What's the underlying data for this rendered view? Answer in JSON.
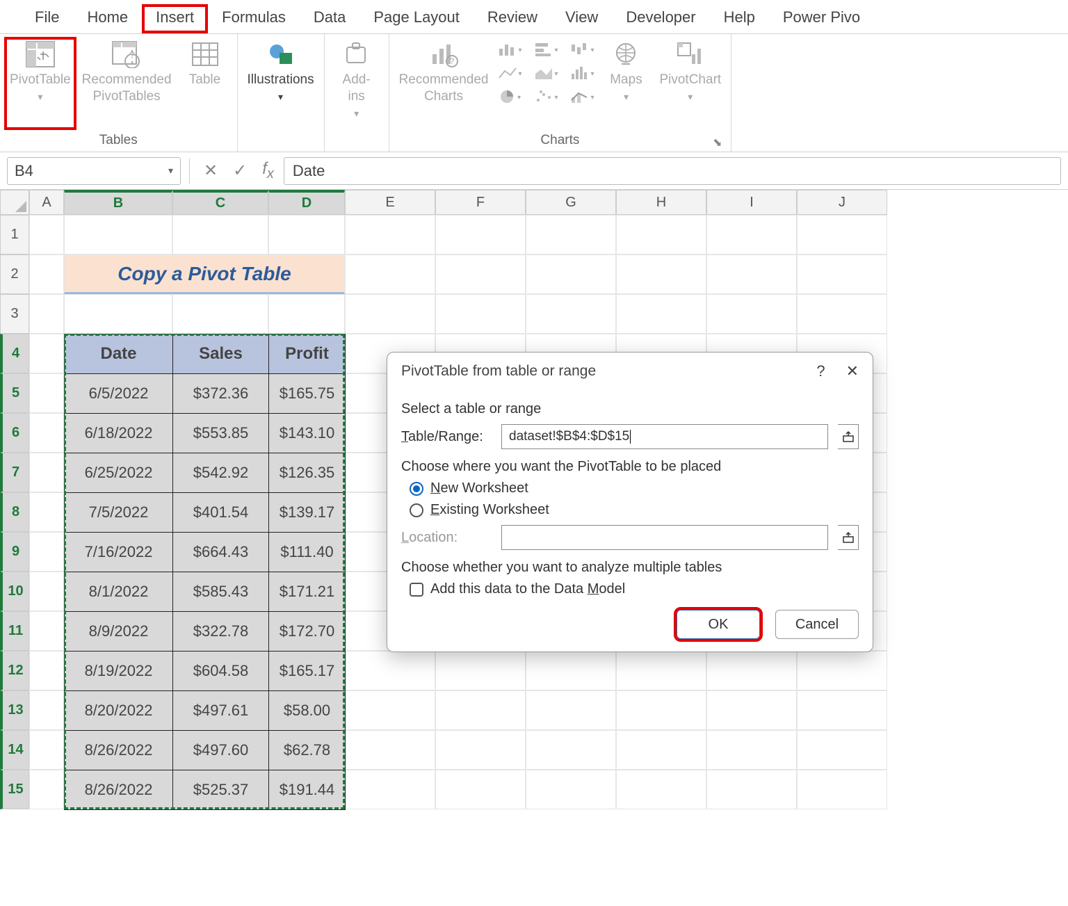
{
  "menu": {
    "file": "File",
    "home": "Home",
    "insert": "Insert",
    "formulas": "Formulas",
    "data": "Data",
    "pageLayout": "Page Layout",
    "review": "Review",
    "view": "View",
    "developer": "Developer",
    "help": "Help",
    "powerPivot": "Power Pivo"
  },
  "ribbon": {
    "pivotTable": "PivotTable",
    "recommendedPivot": "Recommended\nPivotTables",
    "table": "Table",
    "illustrations": "Illustrations",
    "addins": "Add-\nins",
    "recommendedCharts": "Recommended\nCharts",
    "maps": "Maps",
    "pivotChart": "PivotChart",
    "group_tables": "Tables",
    "group_charts": "Charts"
  },
  "formulaBar": {
    "nameBox": "B4",
    "formula": "Date"
  },
  "columns": [
    "A",
    "B",
    "C",
    "D",
    "E",
    "F",
    "G",
    "H",
    "I",
    "J"
  ],
  "rows": [
    "1",
    "2",
    "3",
    "4",
    "5",
    "6",
    "7",
    "8",
    "9",
    "10",
    "11",
    "12",
    "13",
    "14",
    "15"
  ],
  "title": "Copy a Pivot Table",
  "table": {
    "headers": [
      "Date",
      "Sales",
      "Profit"
    ],
    "rows": [
      [
        "6/5/2022",
        "$372.36",
        "$165.75"
      ],
      [
        "6/18/2022",
        "$553.85",
        "$143.10"
      ],
      [
        "6/25/2022",
        "$542.92",
        "$126.35"
      ],
      [
        "7/5/2022",
        "$401.54",
        "$139.17"
      ],
      [
        "7/16/2022",
        "$664.43",
        "$111.40"
      ],
      [
        "8/1/2022",
        "$585.43",
        "$171.21"
      ],
      [
        "8/9/2022",
        "$322.78",
        "$172.70"
      ],
      [
        "8/19/2022",
        "$604.58",
        "$165.17"
      ],
      [
        "8/20/2022",
        "$497.61",
        "$58.00"
      ],
      [
        "8/26/2022",
        "$497.60",
        "$62.78"
      ],
      [
        "8/26/2022",
        "$525.37",
        "$191.44"
      ]
    ]
  },
  "dialog": {
    "title": "PivotTable from table or range",
    "section1": "Select a table or range",
    "tableRangeLabel": "Table/Range:",
    "tableRangeValue": "dataset!$B$4:$D$15",
    "section2": "Choose where you want the PivotTable to be placed",
    "optNew": "New Worksheet",
    "optExisting": "Existing Worksheet",
    "locationLabel": "Location:",
    "locationValue": "",
    "section3": "Choose whether you want to analyze multiple tables",
    "dataModel": "Add this data to the Data Model",
    "ok": "OK",
    "cancel": "Cancel",
    "help": "?",
    "close": "✕"
  }
}
